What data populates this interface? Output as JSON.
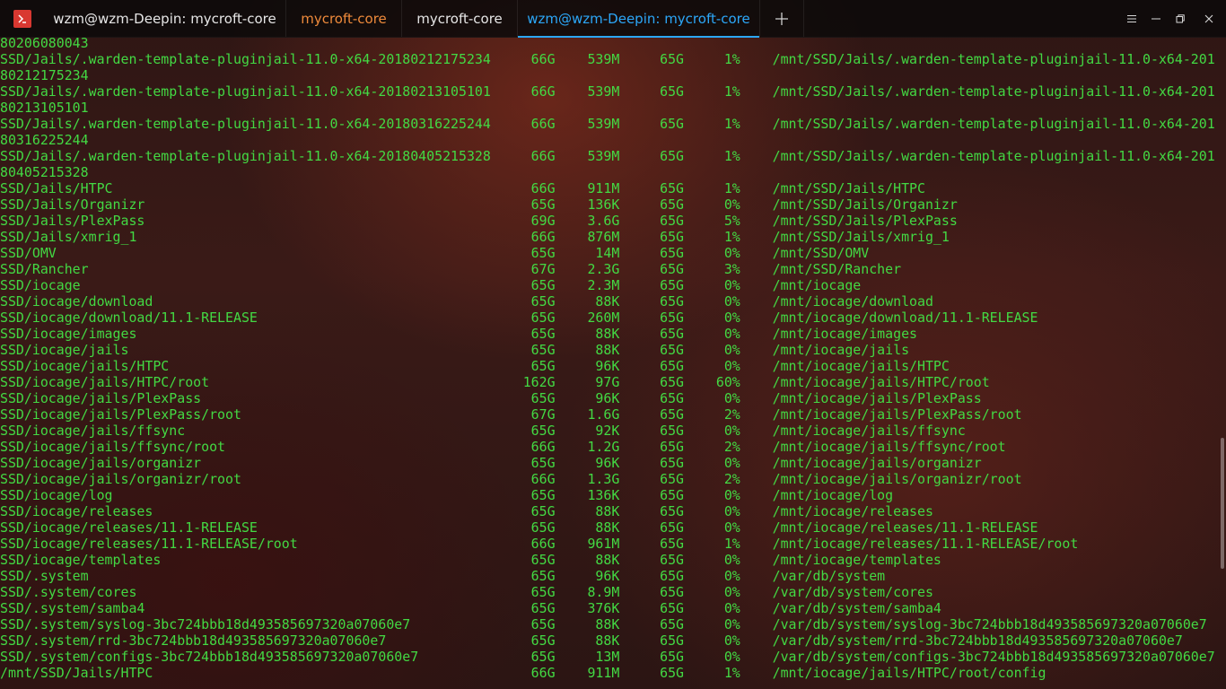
{
  "window": {
    "tabs": [
      {
        "label": "wzm@wzm-Deepin: mycroft-core"
      },
      {
        "label": "mycroft-core"
      },
      {
        "label": "mycroft-core"
      },
      {
        "label": "wzm@wzm-Deepin: mycroft-core"
      }
    ],
    "active_tab": 3,
    "colors": {
      "accent": "#2ca7f8",
      "orange_tab": "#ee8a3b",
      "terminal_text": "#43d943",
      "app_icon": "#d93831"
    },
    "icons": [
      "terminal-app-icon",
      "plus-icon",
      "menu-icon",
      "minimize-icon",
      "maximize-icon",
      "close-icon"
    ]
  },
  "terminal": {
    "lines": [
      "80206080043",
      "SSD/Jails/.warden-template-pluginjail-11.0-x64-20180212175234     66G    539M     65G     1%    /mnt/SSD/Jails/.warden-template-pluginjail-11.0-x64-201",
      "80212175234",
      "SSD/Jails/.warden-template-pluginjail-11.0-x64-20180213105101     66G    539M     65G     1%    /mnt/SSD/Jails/.warden-template-pluginjail-11.0-x64-201",
      "80213105101",
      "SSD/Jails/.warden-template-pluginjail-11.0-x64-20180316225244     66G    539M     65G     1%    /mnt/SSD/Jails/.warden-template-pluginjail-11.0-x64-201",
      "80316225244",
      "SSD/Jails/.warden-template-pluginjail-11.0-x64-20180405215328     66G    539M     65G     1%    /mnt/SSD/Jails/.warden-template-pluginjail-11.0-x64-201",
      "80405215328",
      "SSD/Jails/HTPC                                                    66G    911M     65G     1%    /mnt/SSD/Jails/HTPC",
      "SSD/Jails/Organizr                                                65G    136K     65G     0%    /mnt/SSD/Jails/Organizr",
      "SSD/Jails/PlexPass                                                69G    3.6G     65G     5%    /mnt/SSD/Jails/PlexPass",
      "SSD/Jails/xmrig_1                                                 66G    876M     65G     1%    /mnt/SSD/Jails/xmrig_1",
      "SSD/OMV                                                           65G     14M     65G     0%    /mnt/SSD/OMV",
      "SSD/Rancher                                                       67G    2.3G     65G     3%    /mnt/SSD/Rancher",
      "SSD/iocage                                                        65G    2.3M     65G     0%    /mnt/iocage",
      "SSD/iocage/download                                               65G     88K     65G     0%    /mnt/iocage/download",
      "SSD/iocage/download/11.1-RELEASE                                  65G    260M     65G     0%    /mnt/iocage/download/11.1-RELEASE",
      "SSD/iocage/images                                                 65G     88K     65G     0%    /mnt/iocage/images",
      "SSD/iocage/jails                                                  65G     88K     65G     0%    /mnt/iocage/jails",
      "SSD/iocage/jails/HTPC                                             65G     96K     65G     0%    /mnt/iocage/jails/HTPC",
      "SSD/iocage/jails/HTPC/root                                       162G     97G     65G    60%    /mnt/iocage/jails/HTPC/root",
      "SSD/iocage/jails/PlexPass                                         65G     96K     65G     0%    /mnt/iocage/jails/PlexPass",
      "SSD/iocage/jails/PlexPass/root                                    67G    1.6G     65G     2%    /mnt/iocage/jails/PlexPass/root",
      "SSD/iocage/jails/ffsync                                           65G     92K     65G     0%    /mnt/iocage/jails/ffsync",
      "SSD/iocage/jails/ffsync/root                                      66G    1.2G     65G     2%    /mnt/iocage/jails/ffsync/root",
      "SSD/iocage/jails/organizr                                         65G     96K     65G     0%    /mnt/iocage/jails/organizr",
      "SSD/iocage/jails/organizr/root                                    66G    1.3G     65G     2%    /mnt/iocage/jails/organizr/root",
      "SSD/iocage/log                                                    65G    136K     65G     0%    /mnt/iocage/log",
      "SSD/iocage/releases                                               65G     88K     65G     0%    /mnt/iocage/releases",
      "SSD/iocage/releases/11.1-RELEASE                                  65G     88K     65G     0%    /mnt/iocage/releases/11.1-RELEASE",
      "SSD/iocage/releases/11.1-RELEASE/root                             66G    961M     65G     1%    /mnt/iocage/releases/11.1-RELEASE/root",
      "SSD/iocage/templates                                              65G     88K     65G     0%    /mnt/iocage/templates",
      "SSD/.system                                                       65G     96K     65G     0%    /var/db/system",
      "SSD/.system/cores                                                 65G    8.9M     65G     0%    /var/db/system/cores",
      "SSD/.system/samba4                                                65G    376K     65G     0%    /var/db/system/samba4",
      "SSD/.system/syslog-3bc724bbb18d493585697320a07060e7               65G     88K     65G     0%    /var/db/system/syslog-3bc724bbb18d493585697320a07060e7",
      "SSD/.system/rrd-3bc724bbb18d493585697320a07060e7                  65G     88K     65G     0%    /var/db/system/rrd-3bc724bbb18d493585697320a07060e7",
      "SSD/.system/configs-3bc724bbb18d493585697320a07060e7              65G     13M     65G     0%    /var/db/system/configs-3bc724bbb18d493585697320a07060e7",
      "/mnt/SSD/Jails/HTPC                                               66G    911M     65G     1%    /mnt/iocage/jails/HTPC/root/config"
    ]
  }
}
